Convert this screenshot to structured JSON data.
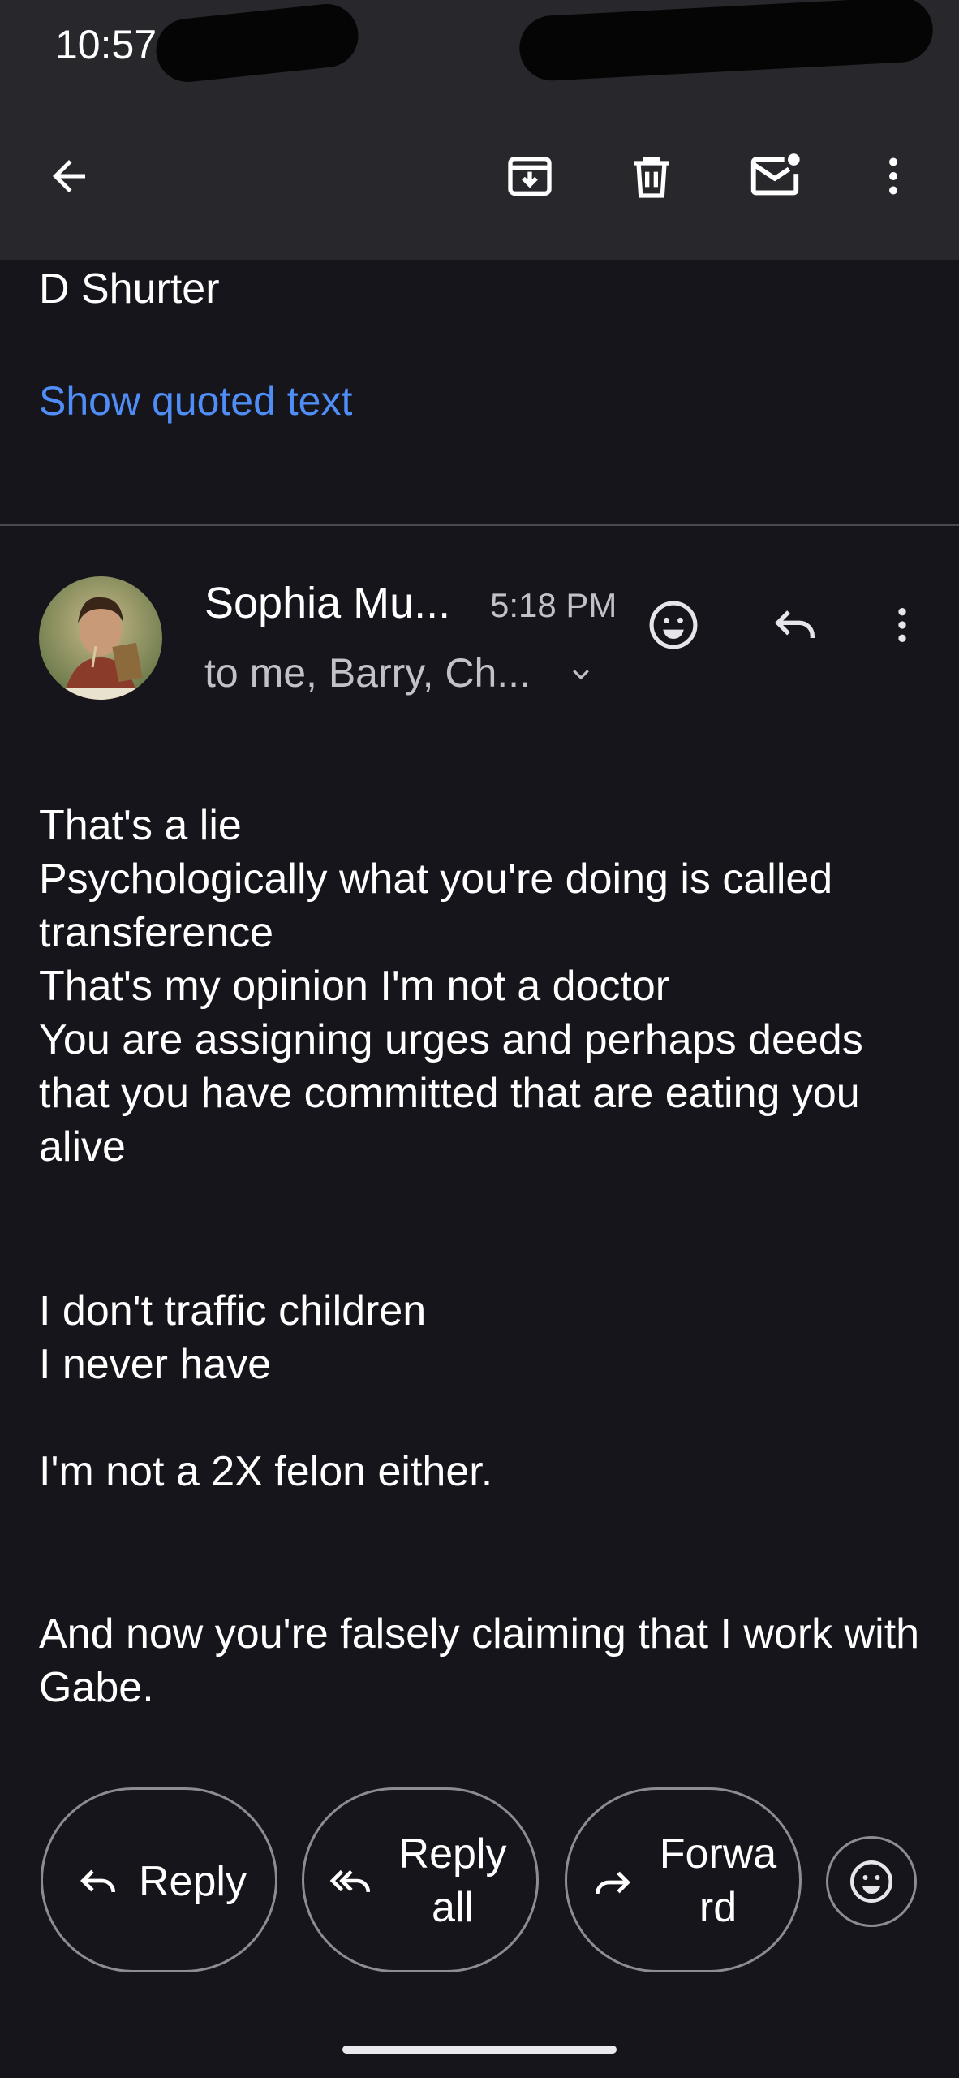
{
  "status_bar": {
    "time": "10:57"
  },
  "toolbar": {
    "back_icon": "arrow-left-icon",
    "archive_icon": "archive-icon",
    "delete_icon": "trash-icon",
    "mark_unread_icon": "mail-unread-icon",
    "more_icon": "more-vert-icon"
  },
  "previous_message": {
    "sender": "D Shurter",
    "show_quoted": "Show quoted text"
  },
  "message": {
    "sender": "Sophia Mu...",
    "time": "5:18 PM",
    "recipients": "to me, Barry, Ch...",
    "body": {
      "p1": "That's a lie\nPsychologically what you're doing is called transference\nThat's my opinion I'm not a doctor\nYou are assigning urges and perhaps deeds that you have committed that are eating you alive",
      "p2": "I don't traffic children\nI never have",
      "p3": "I'm not a 2X felon either.",
      "p4": "And now you're falsely claiming that I work with Gabe."
    }
  },
  "actions": {
    "reply": "Reply",
    "reply_all_line1": "Reply",
    "reply_all_line2": "all",
    "forward_line1": "Forwa",
    "forward_line2": "rd"
  },
  "colors": {
    "background": "#16151b",
    "toolbar": "#28272c",
    "link": "#4f8ef7"
  }
}
